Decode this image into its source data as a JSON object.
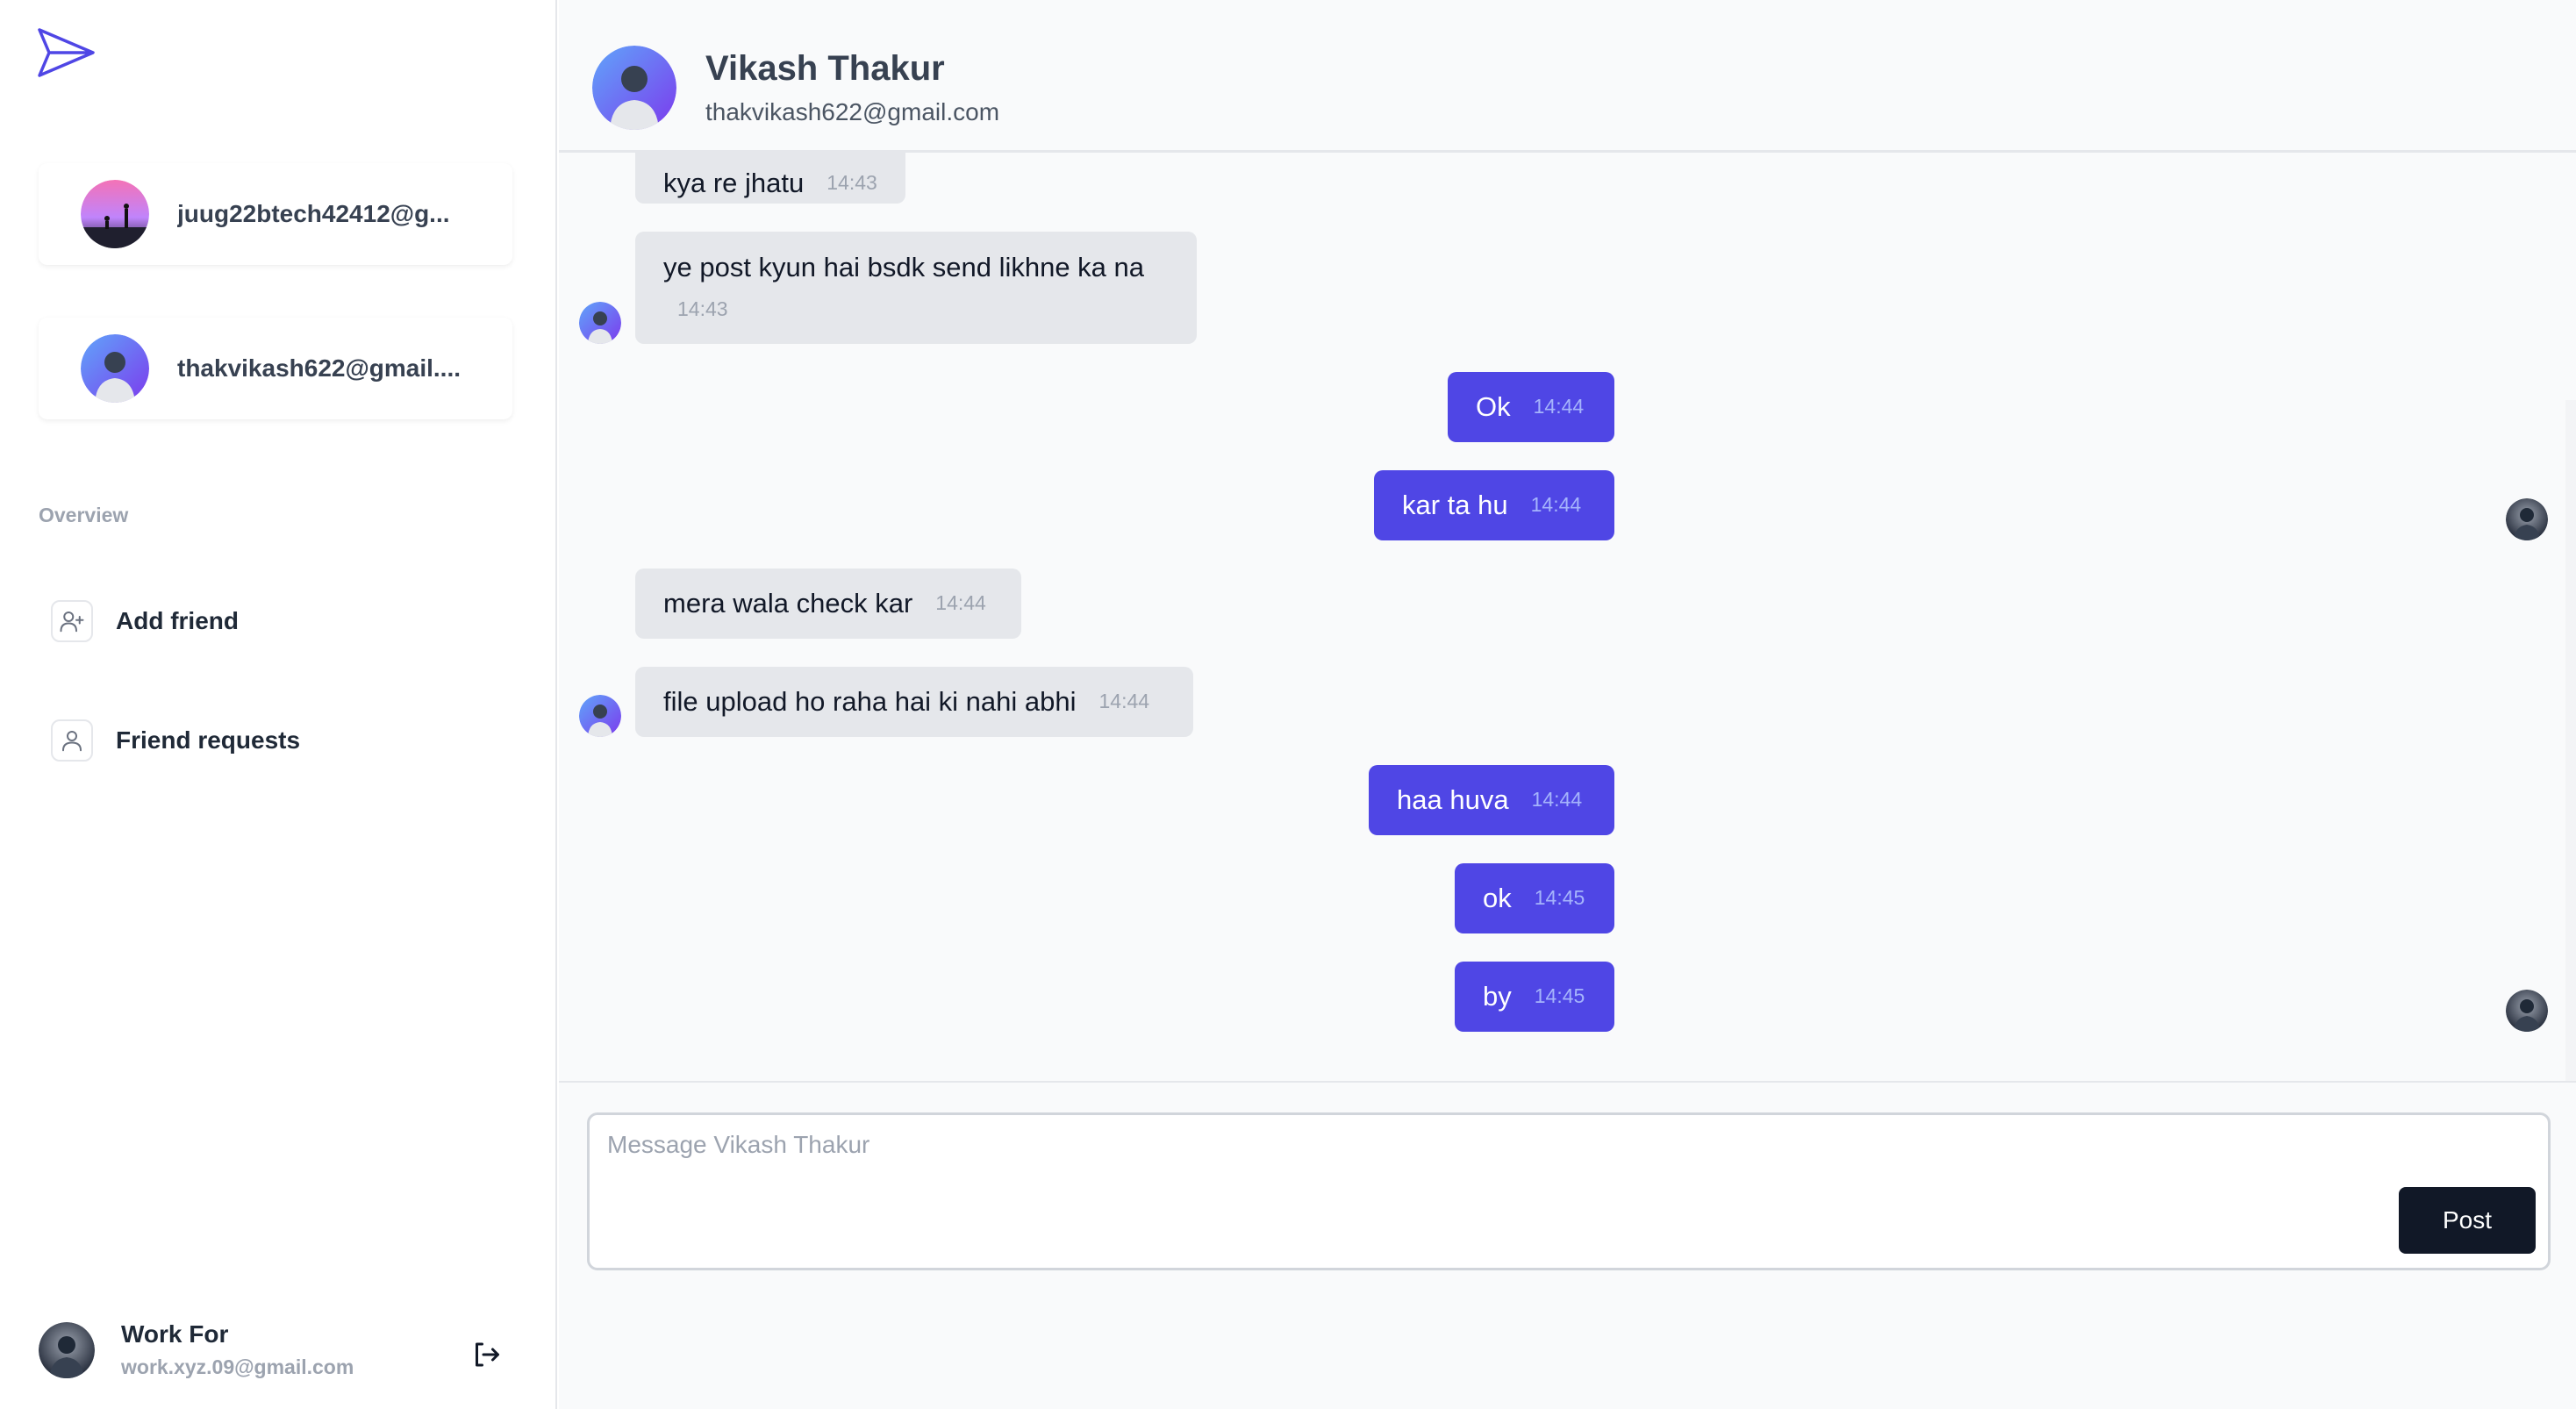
{
  "sidebar": {
    "chats": [
      {
        "label": "juug22btech42412@g...",
        "avatar_icon": "user-avatar-sunset"
      },
      {
        "label": "thakvikash622@gmail....",
        "avatar_icon": "user-avatar-man"
      }
    ],
    "section_label": "Overview",
    "nav": [
      {
        "label": "Add friend",
        "icon": "user-plus-icon"
      },
      {
        "label": "Friend requests",
        "icon": "user-icon"
      }
    ],
    "profile": {
      "name": "Work For",
      "email": "work.xyz.09@gmail.com"
    }
  },
  "header": {
    "name": "Vikash Thakur",
    "email": "thakvikash622@gmail.com"
  },
  "messages": [
    {
      "direction": "in",
      "text": "kya re jhatu",
      "time": "14:43"
    },
    {
      "direction": "in",
      "text": "ye post kyun hai bsdk send likhne ka na",
      "time": "14:43"
    },
    {
      "direction": "out",
      "text": "Ok",
      "time": "14:44"
    },
    {
      "direction": "out",
      "text": "kar ta hu",
      "time": "14:44"
    },
    {
      "direction": "in",
      "text": "mera wala check kar",
      "time": "14:44"
    },
    {
      "direction": "in",
      "text": "file upload ho raha hai ki nahi abhi",
      "time": "14:44"
    },
    {
      "direction": "out",
      "text": "haa huva",
      "time": "14:44"
    },
    {
      "direction": "out",
      "text": "ok",
      "time": "14:45"
    },
    {
      "direction": "out",
      "text": "by",
      "time": "14:45"
    }
  ],
  "composer": {
    "placeholder": "Message Vikash Thakur",
    "post_label": "Post"
  },
  "colors": {
    "accent": "#4f46e5",
    "incoming_bubble": "#e5e7eb",
    "post_button": "#111827"
  }
}
